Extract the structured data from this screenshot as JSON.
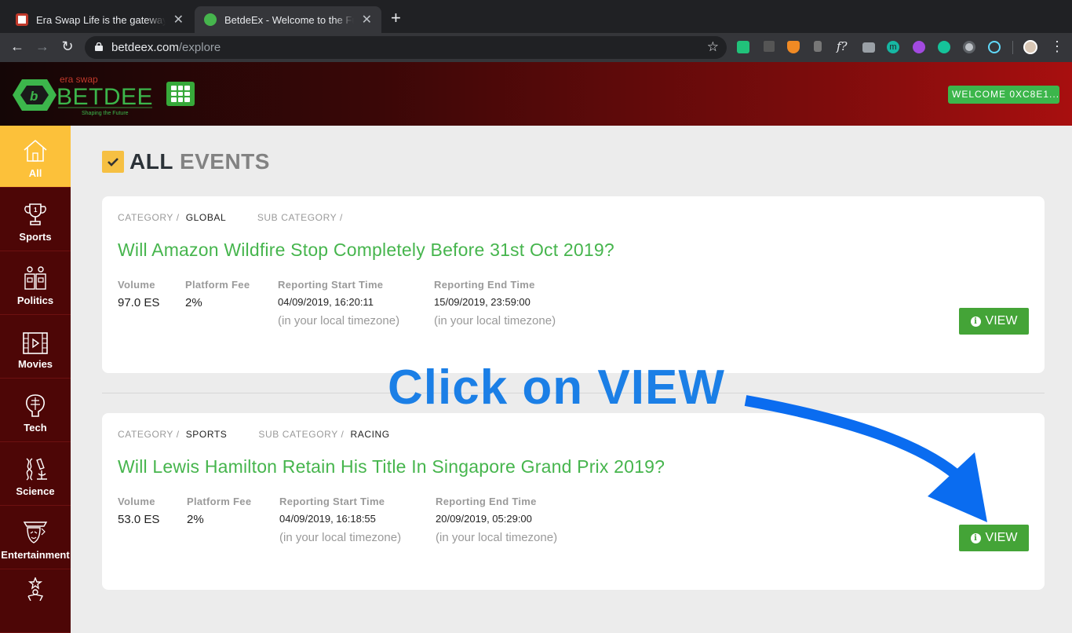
{
  "browser": {
    "tabs": [
      {
        "title": "Era Swap Life is the gateway to",
        "favicon": "eraswap-life-favicon"
      },
      {
        "title": "BetdeEx - Welcome to the Future",
        "favicon": "betdeex-favicon",
        "active": true
      }
    ],
    "new_tab": "+",
    "url_host": "betdeex.com",
    "url_path": "/explore",
    "extension_icons": [
      "cloud-ext-icon",
      "pen-ext-icon",
      "metamask-ext-icon",
      "bottle-ext-icon",
      "fx-ext-icon",
      "camera-ext-icon",
      "m-ext-icon",
      "privacy-ext-icon",
      "grammarly-ext-icon",
      "circle-ext-icon",
      "react-ext-icon",
      "profile-avatar"
    ],
    "fx_label": "f?",
    "m_label": "m"
  },
  "header": {
    "logo_top": "era swap",
    "logo_main": "BETDEEX",
    "logo_tagline": "Shaping the Future",
    "welcome": "WELCOME 0XC8E1..."
  },
  "sidebar": {
    "items": [
      {
        "label": "All",
        "icon": "home-icon",
        "active": true
      },
      {
        "label": "Sports",
        "icon": "trophy-icon"
      },
      {
        "label": "Politics",
        "icon": "podium-icon"
      },
      {
        "label": "Movies",
        "icon": "film-icon"
      },
      {
        "label": "Tech",
        "icon": "brain-chip-icon"
      },
      {
        "label": "Science",
        "icon": "microscope-icon"
      },
      {
        "label": "Entertainment",
        "icon": "mask-icon"
      },
      {
        "label": "",
        "icon": "star-person-icon"
      }
    ]
  },
  "page": {
    "title_bold": "ALL",
    "title_grey": "EVENTS"
  },
  "labels": {
    "category": "CATEGORY /",
    "sub_category": "SUB CATEGORY /",
    "volume": "Volume",
    "platform_fee": "Platform Fee",
    "start_time": "Reporting Start Time",
    "end_time": "Reporting End Time",
    "timezone_note": "(in your local timezone)",
    "view": "VIEW",
    "info": "i"
  },
  "events": [
    {
      "category": "GLOBAL",
      "sub_category": "",
      "title": "Will Amazon Wildfire Stop Completely Before 31st Oct 2019?",
      "volume": "97.0 ES",
      "fee": "2%",
      "start": "04/09/2019, 16:20:11",
      "end": "15/09/2019, 23:59:00"
    },
    {
      "category": "SPORTS",
      "sub_category": "RACING",
      "title": "Will Lewis Hamilton Retain His Title In Singapore Grand Prix 2019?",
      "volume": "53.0 ES",
      "fee": "2%",
      "start": "04/09/2019, 16:18:55",
      "end": "20/09/2019, 05:29:00"
    }
  ],
  "annotation": {
    "text": "Click on VIEW",
    "color": "#1b7fe6"
  },
  "colors": {
    "brand_green": "#46b54d",
    "button_green": "#44a437",
    "sidebar_active": "#fcc13a",
    "sidebar_bg": "#500707"
  }
}
